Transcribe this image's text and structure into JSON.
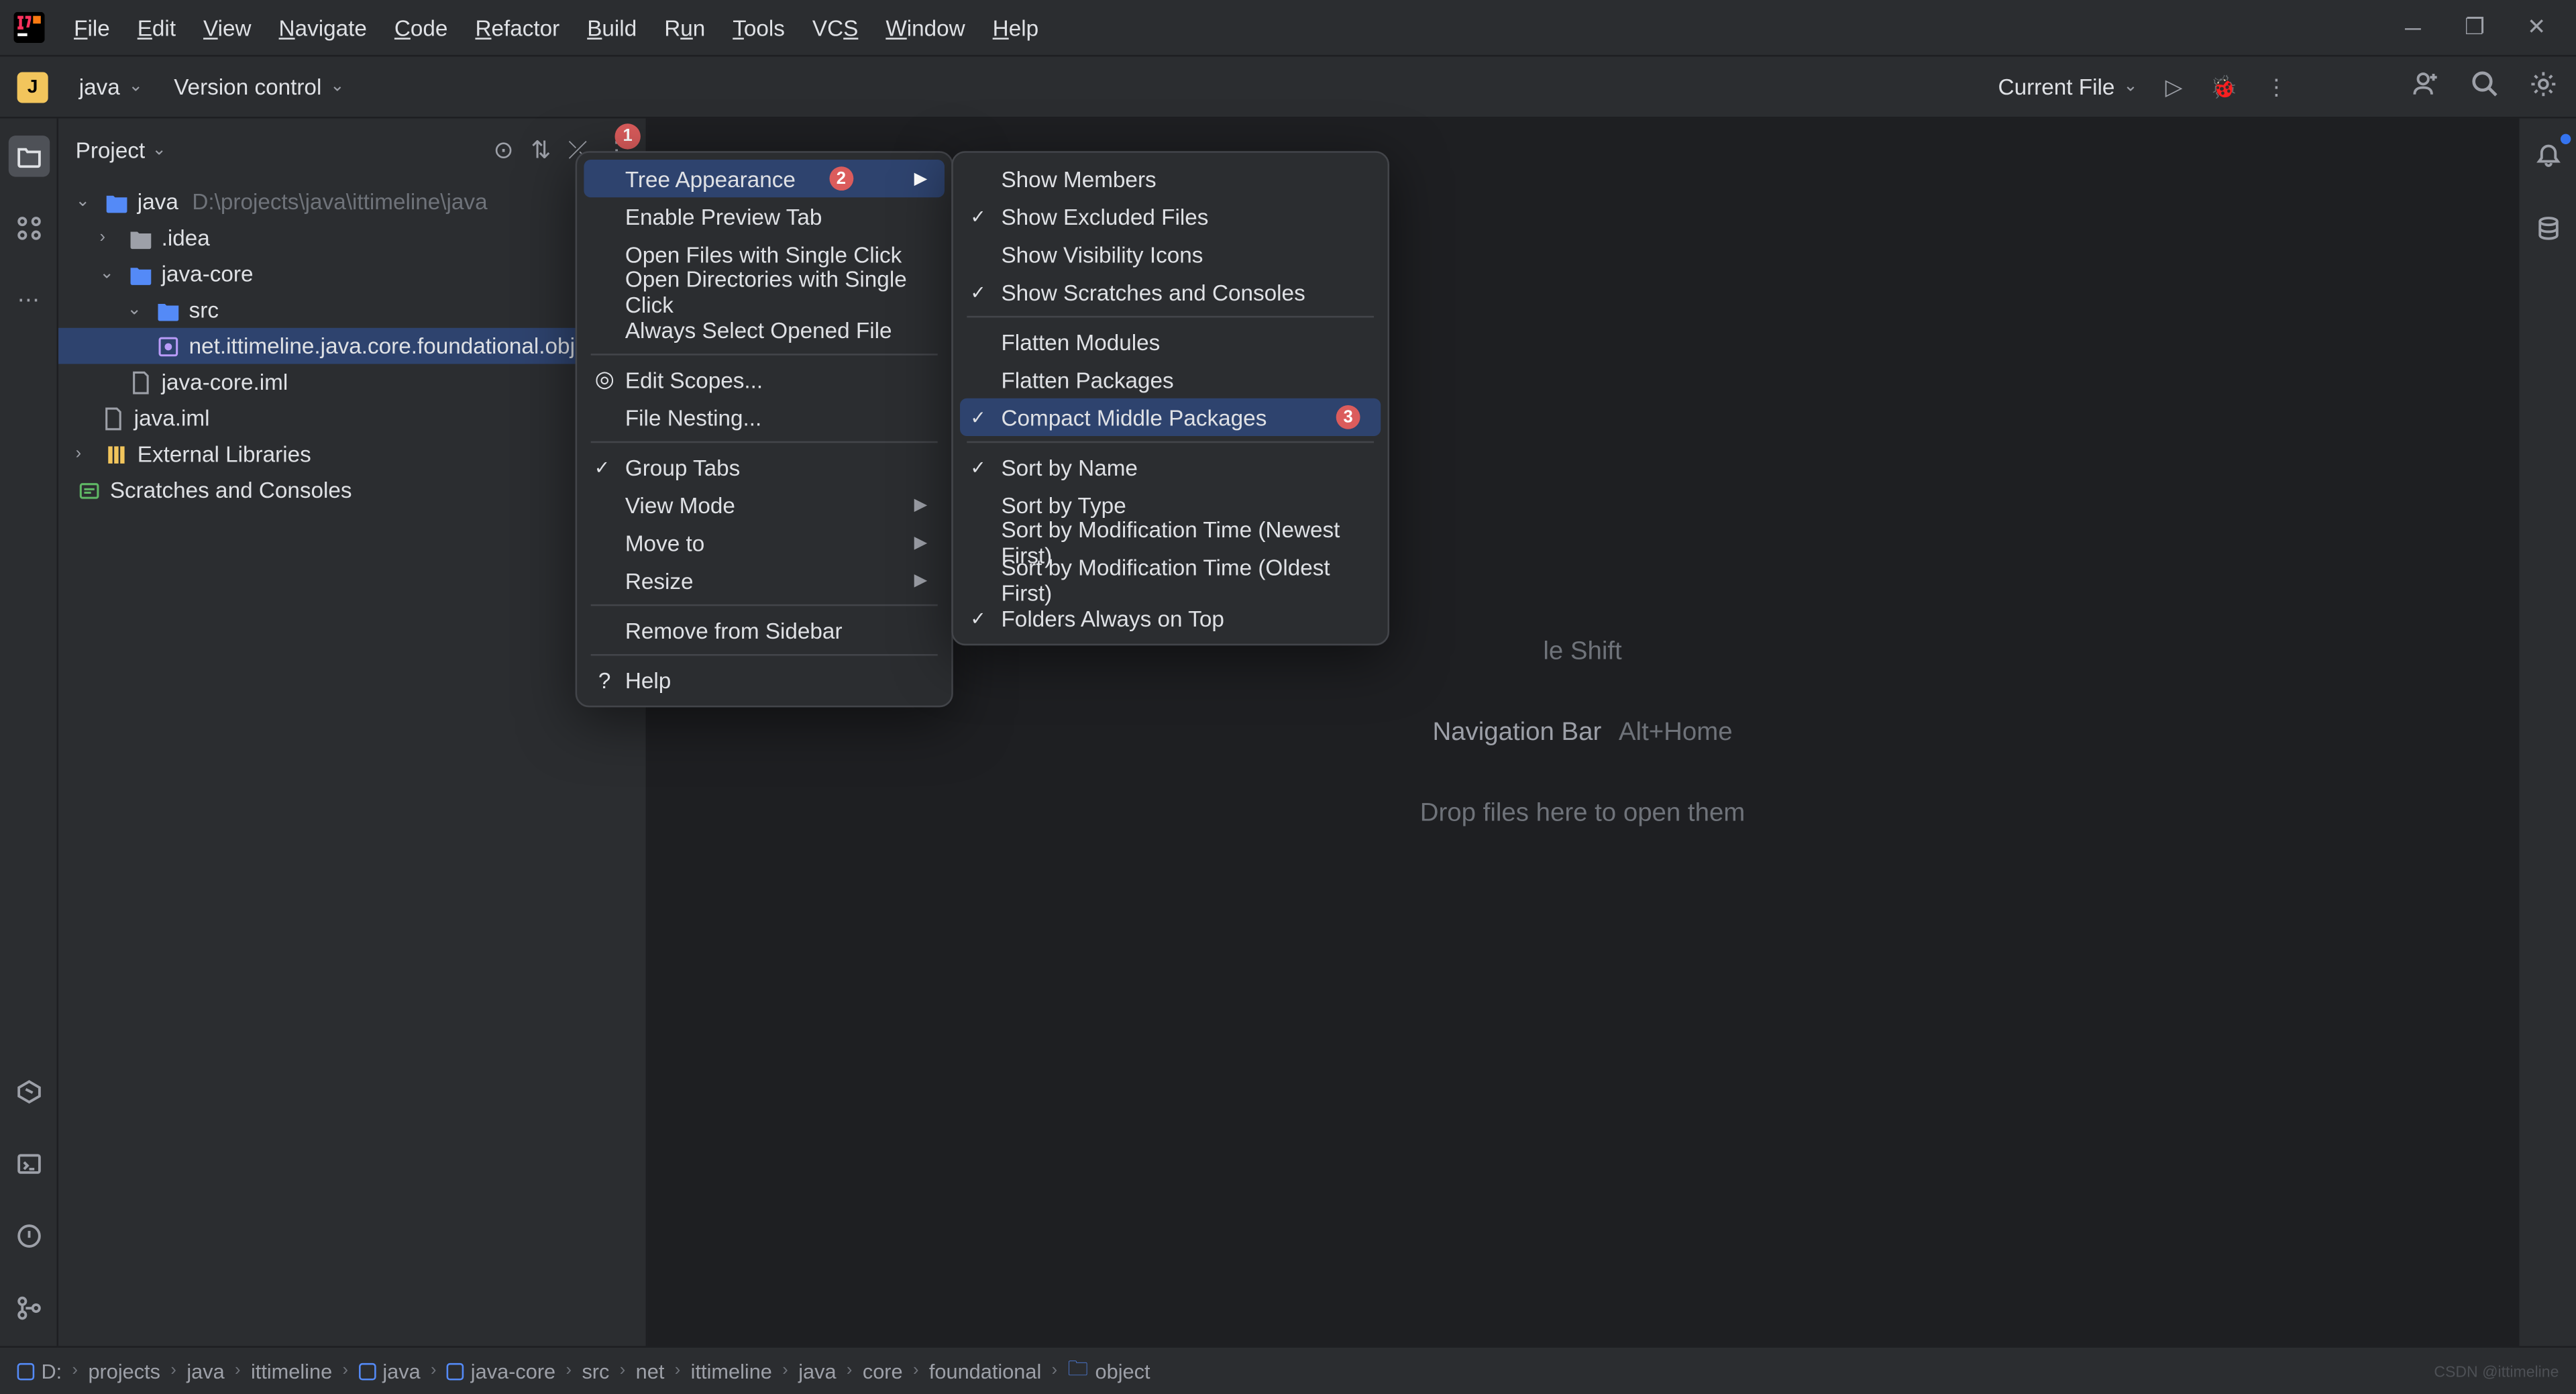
{
  "menubar": [
    "File",
    "Edit",
    "View",
    "Navigate",
    "Code",
    "Refactor",
    "Build",
    "Run",
    "Tools",
    "VCS",
    "Window",
    "Help"
  ],
  "toolbar": {
    "project_letter": "J",
    "project_name": "java",
    "vcs_label": "Version control",
    "run_target": "Current File"
  },
  "panel": {
    "title": "Project",
    "more_badge": "1"
  },
  "tree": {
    "root_name": "java",
    "root_path": "D:\\projects\\java\\ittimeline\\java",
    "idea": ".idea",
    "core": "java-core",
    "src": "src",
    "pkg": "net.ittimeline.java.core.foundational.obje",
    "core_iml": "java-core.iml",
    "java_iml": "java.iml",
    "ext_lib": "External Libraries",
    "scratch": "Scratches and Consoles"
  },
  "editor": {
    "search_hint_suffix": "le Shift",
    "nav_bar_label": "Navigation Bar",
    "nav_bar_key": "Alt+Home",
    "drop_hint": "Drop files here to open them"
  },
  "menu1": {
    "tree_appearance": "Tree Appearance",
    "tree_badge": "2",
    "enable_preview": "Enable Preview Tab",
    "open_files_single": "Open Files with Single Click",
    "open_dirs_single": "Open Directories with Single Click",
    "always_select": "Always Select Opened File",
    "edit_scopes": "Edit Scopes...",
    "file_nesting": "File Nesting...",
    "group_tabs": "Group Tabs",
    "view_mode": "View Mode",
    "move_to": "Move to",
    "resize": "Resize",
    "remove_sidebar": "Remove from Sidebar",
    "help": "Help"
  },
  "menu2": {
    "show_members": "Show Members",
    "show_excluded": "Show Excluded Files",
    "show_visibility": "Show Visibility Icons",
    "show_scratches": "Show Scratches and Consoles",
    "flatten_modules": "Flatten Modules",
    "flatten_packages": "Flatten Packages",
    "compact_middle": "Compact Middle Packages",
    "compact_badge": "3",
    "sort_name": "Sort by Name",
    "sort_type": "Sort by Type",
    "sort_mod_new": "Sort by Modification Time (Newest First)",
    "sort_mod_old": "Sort by Modification Time (Oldest First)",
    "folders_top": "Folders Always on Top"
  },
  "breadcrumb": [
    "D:",
    "projects",
    "java",
    "ittimeline",
    "java",
    "java-core",
    "src",
    "net",
    "ittimeline",
    "java",
    "core",
    "foundational",
    "object"
  ],
  "watermark": "CSDN @ittimeline"
}
